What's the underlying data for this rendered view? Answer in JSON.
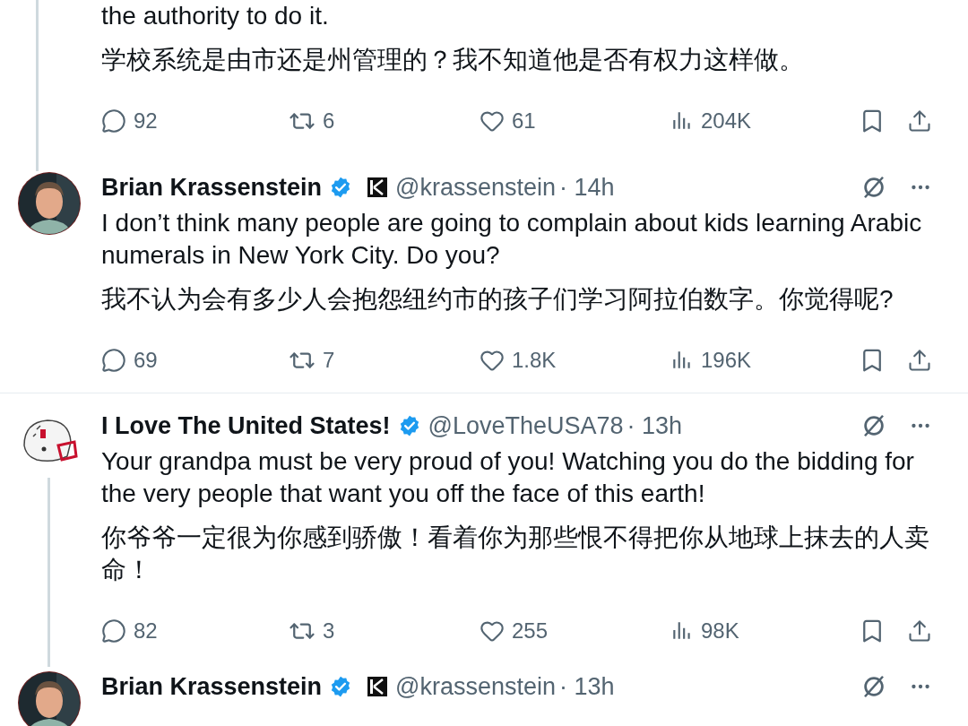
{
  "tweets": [
    {
      "kind": "continued",
      "thread_below": true,
      "paragraphs": [
        "the authority to do it.",
        "学校系统是由市还是州管理的？我不知道他是否有权力这样做。"
      ],
      "stats": {
        "replies": "92",
        "reposts": "6",
        "likes": "61",
        "views": "204K"
      }
    },
    {
      "kind": "full",
      "thread_below": false,
      "name": "Brian Krassenstein",
      "verified": true,
      "affiliate": true,
      "handle": "@krassenstein",
      "time": "· 14h",
      "paragraphs": [
        "I don’t think many people are going to complain about kids learning Arabic numerals in New York City. Do you?",
        "我不认为会有多少人会抱怨纽约市的孩子们学习阿拉伯数字。你觉得呢?"
      ],
      "stats": {
        "replies": "69",
        "reposts": "7",
        "likes": "1.8K",
        "views": "196K"
      }
    },
    {
      "kind": "full",
      "avatar": {
        "kind": "helmet"
      },
      "thread_below": true,
      "name": "I Love The United States!",
      "verified": true,
      "affiliate": false,
      "handle": "@LoveTheUSA78",
      "time": "· 13h",
      "paragraphs": [
        "Your grandpa must be very proud of you!  Watching you do the bidding for the very people that want you off the face of this earth!",
        "你爷爷一定很为你感到骄傲！看着你为那些恨不得把你从地球上抹去的人卖命！"
      ],
      "stats": {
        "replies": "82",
        "reposts": "3",
        "likes": "255",
        "views": "98K"
      }
    },
    {
      "kind": "header",
      "name": "Brian Krassenstein",
      "verified": true,
      "affiliate": true,
      "handle": "@krassenstein",
      "time": "· 13h"
    }
  ]
}
